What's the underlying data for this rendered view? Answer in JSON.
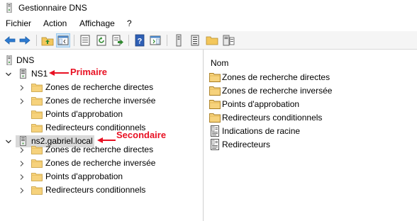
{
  "window": {
    "title": "Gestionnaire DNS",
    "icon": "dns-manager-icon"
  },
  "menu": [
    "Fichier",
    "Action",
    "Affichage",
    "?"
  ],
  "toolbar": {
    "buttons": [
      "back-arrow-icon",
      "forward-arrow-icon",
      "up-folder-icon",
      "show-hide-tree-icon",
      "properties-icon",
      "refresh-icon",
      "export-list-icon",
      "help-icon",
      "show-hide-action-pane-icon",
      "server-icon",
      "tasks-icon",
      "folder-icon",
      "server-properties-icon"
    ]
  },
  "tree": {
    "root": "DNS",
    "servers": [
      {
        "name": "NS1",
        "annotation": "Primaire",
        "children": [
          "Zones de recherche directes",
          "Zones de recherche inversée",
          "Points d'approbation",
          "Redirecteurs conditionnels"
        ]
      },
      {
        "name": "ns2.gabriel.local",
        "annotation": "Secondaire",
        "children": [
          "Zones de recherche directes",
          "Zones de recherche inversée",
          "Points d'approbation",
          "Redirecteurs conditionnels"
        ]
      }
    ]
  },
  "list": {
    "column": "Nom",
    "items": [
      {
        "label": "Zones de recherche directes",
        "icon": "folder-icon"
      },
      {
        "label": "Zones de recherche inversée",
        "icon": "folder-icon"
      },
      {
        "label": "Points d'approbation",
        "icon": "folder-icon"
      },
      {
        "label": "Redirecteurs conditionnels",
        "icon": "folder-icon"
      },
      {
        "label": "Indications de racine",
        "icon": "root-hints-icon"
      },
      {
        "label": "Redirecteurs",
        "icon": "forwarders-icon"
      }
    ]
  },
  "colors": {
    "annotation": "#e81123",
    "selection": "#d9d9d9",
    "folder": "#f6d27c"
  }
}
